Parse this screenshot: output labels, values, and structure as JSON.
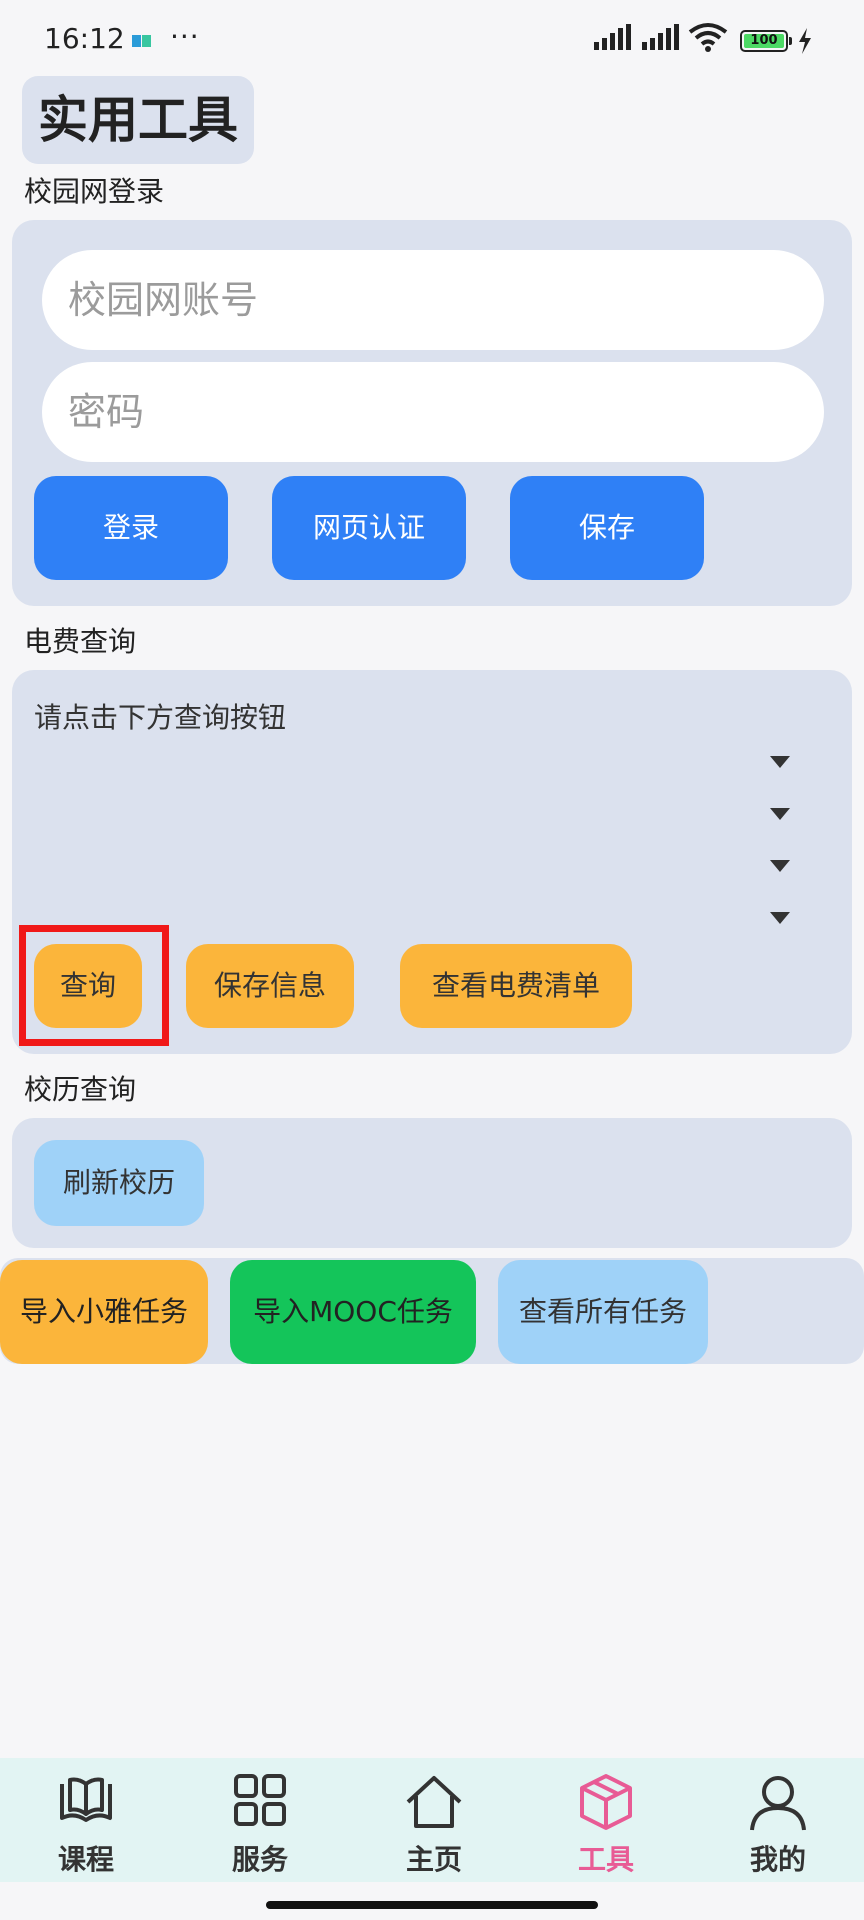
{
  "status_bar": {
    "time": "16:12",
    "more": "···",
    "battery": "100"
  },
  "page": {
    "title": "实用工具"
  },
  "campus_login": {
    "section_label": "校园网登录",
    "account_placeholder": "校园网账号",
    "password_placeholder": "密码",
    "buttons": {
      "login": "登录",
      "web_auth": "网页认证",
      "save": "保存"
    }
  },
  "electric": {
    "section_label": "电费查询",
    "hint": "请点击下方查询按钮",
    "buttons": {
      "query": "查询",
      "save_info": "保存信息",
      "view_bill": "查看电费清单"
    }
  },
  "calendar": {
    "section_label": "校历查询",
    "refresh": "刷新校历"
  },
  "tasks": {
    "import_xiaoya": "导入小雅任务",
    "import_mooc": "导入MOOC任务",
    "view_all": "查看所有任务"
  },
  "bottom_nav": {
    "items": [
      {
        "label": "课程",
        "icon": "book-icon"
      },
      {
        "label": "服务",
        "icon": "grid-icon"
      },
      {
        "label": "主页",
        "icon": "home-icon"
      },
      {
        "label": "工具",
        "icon": "cube-icon",
        "active": true
      },
      {
        "label": "我的",
        "icon": "person-icon"
      }
    ]
  },
  "colors": {
    "accent_blue": "#2f80f6",
    "orange": "#fbb53b",
    "green": "#14c55a",
    "light_blue": "#9fd2f8",
    "active_pink": "#e85b95",
    "card_bg": "#dbe1ee",
    "highlight_red": "#f01818"
  }
}
